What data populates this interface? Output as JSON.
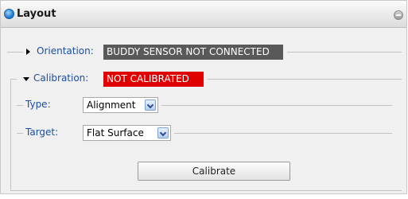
{
  "panel": {
    "title": "Layout"
  },
  "orientation": {
    "label": "Orientation:",
    "status": "BUDDY SENSOR NOT CONNECTED",
    "status_color": "#595959"
  },
  "calibration": {
    "label": "Calibration:",
    "status": "NOT CALIBRATED",
    "status_color": "#e10000",
    "type": {
      "label": "Type:",
      "value": "Alignment"
    },
    "target": {
      "label": "Target:",
      "value": "Flat Surface"
    },
    "button_label": "Calibrate"
  },
  "colors": {
    "label_blue": "#1a4fa0",
    "panel_bg": "#f0f0f0"
  }
}
